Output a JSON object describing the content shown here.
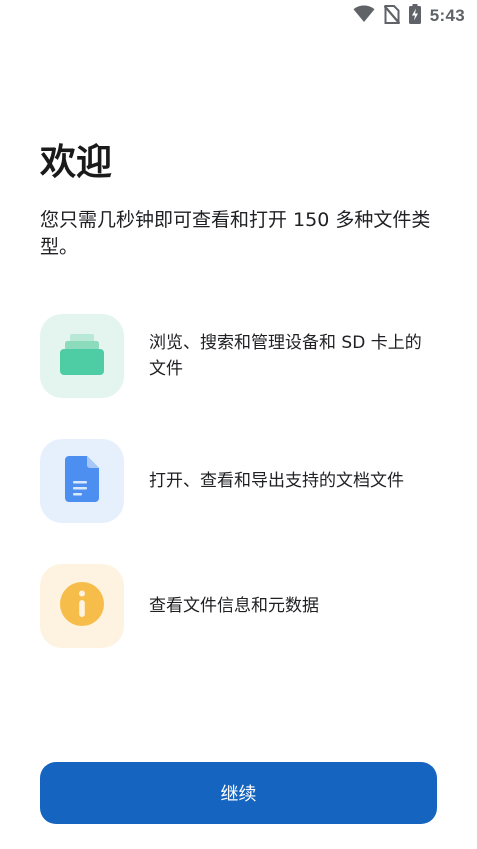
{
  "status_bar": {
    "time": "5:43",
    "icons": [
      "wifi-icon",
      "no-sim-icon",
      "battery-charging-icon"
    ]
  },
  "welcome": {
    "title": "欢迎",
    "subtitle": "您只需几秒钟即可查看和打开 150 多种文件类型。"
  },
  "features": [
    {
      "icon": "folder-stack-icon",
      "text": "浏览、搜索和管理设备和 SD 卡上的文件",
      "tile_color": "#e3f5ee",
      "icon_color": "#4ecca3"
    },
    {
      "icon": "document-icon",
      "text": "打开、查看和导出支持的文档文件",
      "tile_color": "#e6f0fd",
      "icon_color": "#4d8ff0"
    },
    {
      "icon": "info-icon",
      "text": "查看文件信息和元数据",
      "tile_color": "#fdf3e0",
      "icon_color": "#f7bd4a"
    }
  ],
  "actions": {
    "continue_label": "继续",
    "accent_color": "#1565c0"
  }
}
